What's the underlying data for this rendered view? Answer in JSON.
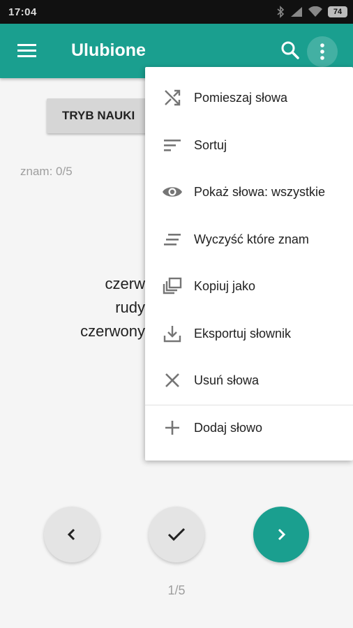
{
  "status_bar": {
    "time": "17:04",
    "battery": "74"
  },
  "app_bar": {
    "title": "Ulubione"
  },
  "main": {
    "learn_mode_label": "TRYB NAUKI",
    "known_count": "znam: 0/5",
    "word_lines": [
      "czerw",
      "rudy",
      "czerwony"
    ],
    "page_indicator": "1/5"
  },
  "overflow_menu": {
    "items": [
      {
        "label": "Pomieszaj słowa",
        "icon": "shuffle-icon"
      },
      {
        "label": "Sortuj",
        "icon": "sort-icon"
      },
      {
        "label": "Pokaż słowa: wszystkie",
        "icon": "eye-icon"
      },
      {
        "label": "Wyczyść które znam",
        "icon": "clear-all-icon"
      },
      {
        "label": "Kopiuj jako",
        "icon": "copy-icon"
      },
      {
        "label": "Eksportuj słownik",
        "icon": "download-icon"
      },
      {
        "label": "Usuń słowa",
        "icon": "close-icon"
      },
      {
        "label": "Dodaj słowo",
        "icon": "plus-icon"
      }
    ]
  },
  "colors": {
    "accent": "#1a9f8f",
    "background": "#f5f5f5",
    "icon_grey": "#757575"
  }
}
